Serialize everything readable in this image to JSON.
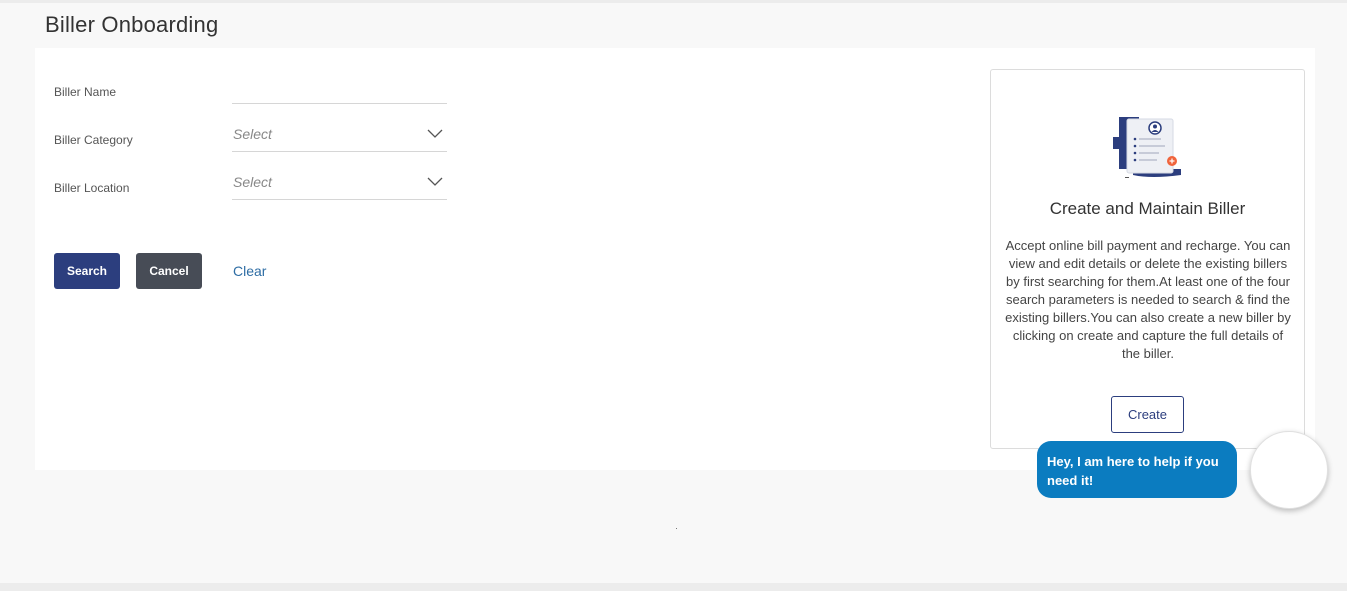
{
  "page": {
    "title": "Biller Onboarding"
  },
  "form": {
    "biller_name": {
      "label": "Biller Name",
      "value": ""
    },
    "biller_category": {
      "label": "Biller Category",
      "value": "Select"
    },
    "biller_location": {
      "label": "Biller Location",
      "value": "Select"
    }
  },
  "actions": {
    "search": "Search",
    "cancel": "Cancel",
    "clear": "Clear"
  },
  "info_card": {
    "title": "Create and Maintain Biller",
    "description": "Accept online bill payment and recharge. You can view and edit details or delete the existing billers by first searching for them.At least one of the four search parameters is needed to search & find the existing billers.You can also create a new biller by clicking on create and capture the full details of the biller.",
    "create_label": "Create"
  },
  "chat": {
    "message": "Hey, I am here to help if you need it!"
  },
  "icons": {
    "illustration": "biller-document-icon",
    "dropdown": "chevron-down-icon"
  },
  "colors": {
    "primary": "#2c3e7e",
    "secondary": "#474c56",
    "link": "#2e6da4",
    "chat": "#0b7cc0",
    "accent": "#f0643c"
  }
}
